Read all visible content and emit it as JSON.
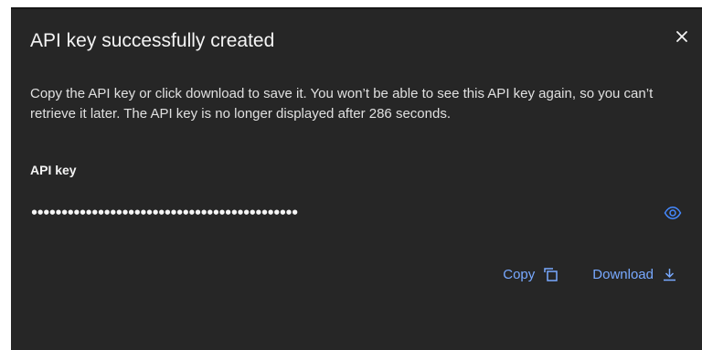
{
  "dialog": {
    "title": "API key successfully created",
    "description": "Copy the API key or click download to save it. You won’t be able to see this API key again, so you can’t retrieve it later. The API key is no longer displayed after 286 seconds.",
    "field_label": "API key",
    "masked_value": "••••••••••••••••••••••••••••••••••••••••••••",
    "copy_label": "Copy",
    "download_label": "Download"
  },
  "icons": {
    "close": "close-icon",
    "visibility": "eye-icon",
    "copy": "copy-icon",
    "download": "download-icon"
  },
  "colors": {
    "dialog_bg": "#262626",
    "text_primary": "#f4f4f4",
    "link": "#78a9ff",
    "icon_accent": "#4589ff"
  }
}
